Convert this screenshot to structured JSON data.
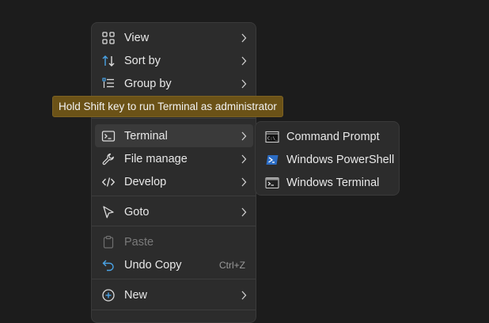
{
  "context_menu": {
    "items": {
      "view": {
        "label": "View",
        "icon": "grid-icon"
      },
      "sort_by": {
        "label": "Sort by",
        "icon": "sort-arrows-icon"
      },
      "group_by": {
        "label": "Group by",
        "icon": "list-group-icon"
      },
      "terminal": {
        "label": "Terminal",
        "icon": "terminal-icon"
      },
      "file_manage": {
        "label": "File manage",
        "icon": "wrench-icon"
      },
      "develop": {
        "label": "Develop",
        "icon": "code-icon"
      },
      "goto": {
        "label": "Goto",
        "icon": "cursor-arrow-icon"
      },
      "paste": {
        "label": "Paste",
        "icon": "clipboard-icon",
        "disabled": true
      },
      "undo_copy": {
        "label": "Undo Copy",
        "icon": "undo-icon",
        "shortcut": "Ctrl+Z"
      },
      "new": {
        "label": "New",
        "icon": "plus-circle-icon"
      }
    }
  },
  "tooltip": {
    "text": "Hold Shift key to run Terminal as administrator"
  },
  "terminal_submenu": {
    "items": [
      {
        "label": "Command Prompt",
        "icon": "command-prompt-icon"
      },
      {
        "label": "Windows PowerShell",
        "icon": "powershell-icon"
      },
      {
        "label": "Windows Terminal",
        "icon": "windows-terminal-icon"
      }
    ]
  },
  "colors": {
    "background": "#1c1c1c",
    "menu_bg": "#2c2c2c",
    "hover_bg": "#3a3a3a",
    "tooltip_bg": "#6b5217",
    "accent_blue": "#4aa3e6"
  }
}
